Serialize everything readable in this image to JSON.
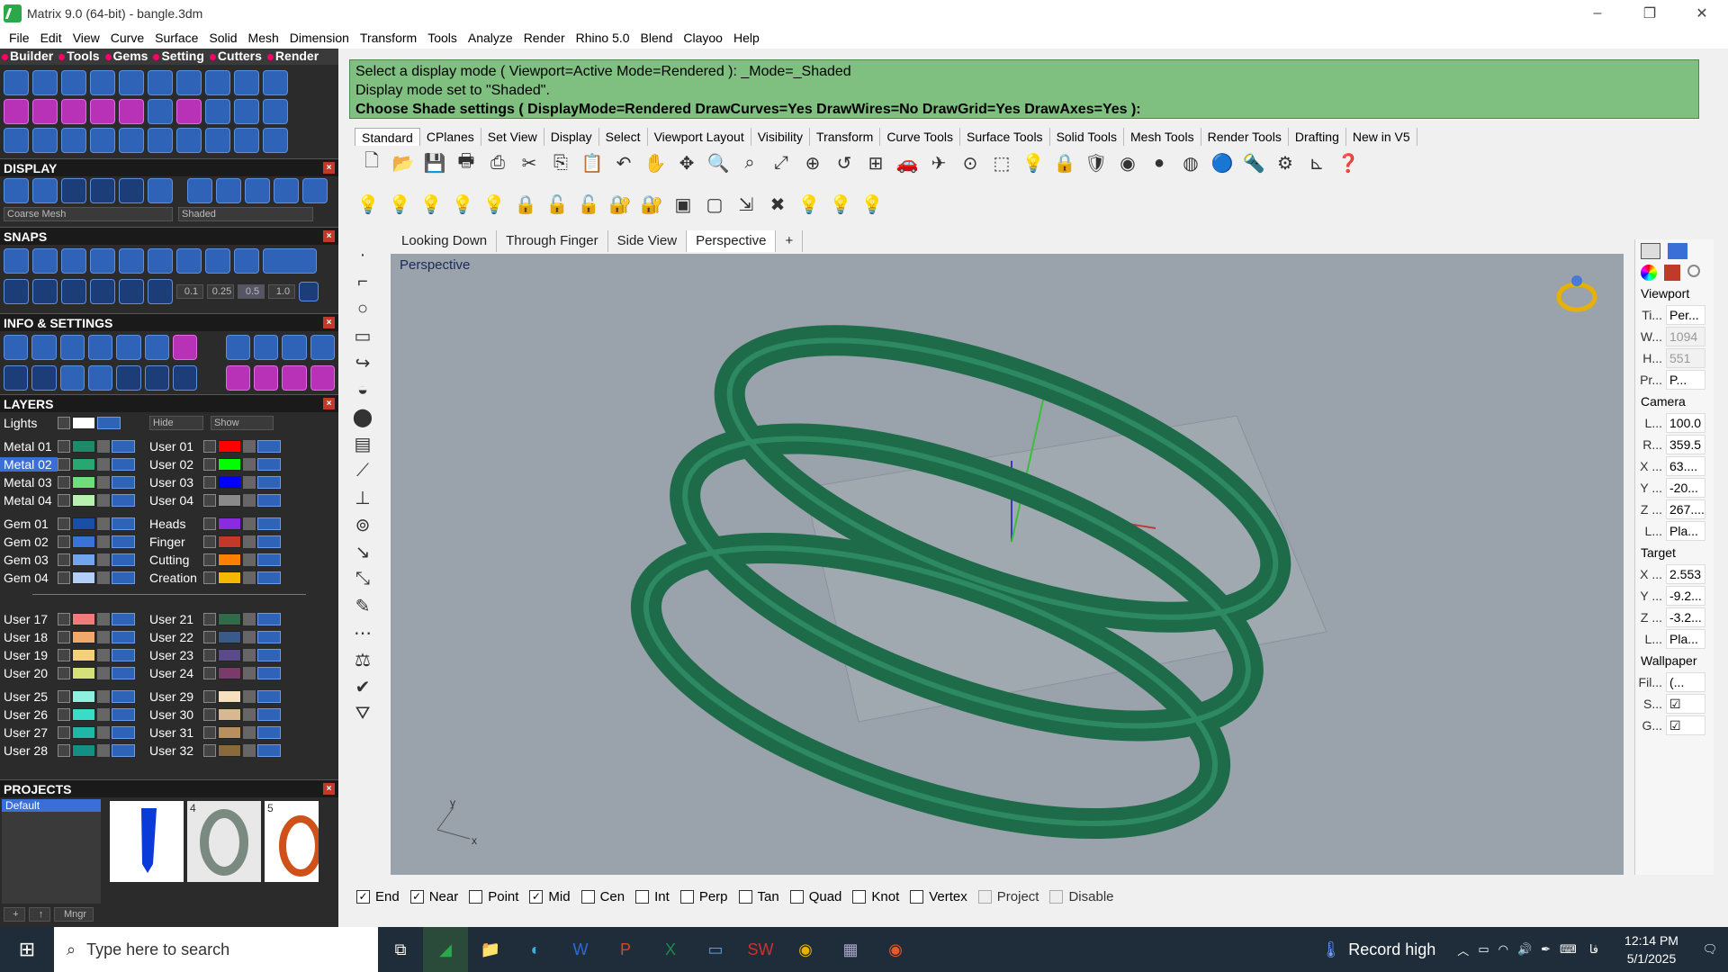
{
  "window": {
    "title": "Matrix 9.0 (64-bit) - bangle.3dm",
    "minimize": "–",
    "restore": "❐",
    "close": "✕"
  },
  "menu": [
    "File",
    "Edit",
    "View",
    "Curve",
    "Surface",
    "Solid",
    "Mesh",
    "Dimension",
    "Transform",
    "Tools",
    "Analyze",
    "Render",
    "Rhino 5.0",
    "Blend",
    "Clayoo",
    "Help"
  ],
  "matrix_tabs": [
    "Builder",
    "Tools",
    "Gems",
    "Setting",
    "Cutters",
    "Render"
  ],
  "display": {
    "header": "DISPLAY",
    "mesh_combo": "Coarse Mesh",
    "mode_combo": "Shaded"
  },
  "snaps": {
    "header": "SNAPS",
    "values": [
      "0.1",
      "0.25",
      "0.5",
      "1.0"
    ]
  },
  "info_settings": {
    "header": "INFO & SETTINGS"
  },
  "layers": {
    "header": "LAYERS",
    "lights": "Lights",
    "hide": "Hide",
    "show": "Show",
    "left_groups": [
      [
        {
          "name": "Metal 01",
          "color": "#1f8a6a"
        },
        {
          "name": "Metal 02",
          "color": "#27a873",
          "selected": true
        },
        {
          "name": "Metal 03",
          "color": "#6fdd7a"
        },
        {
          "name": "Metal 04",
          "color": "#b8f0b0"
        }
      ],
      [
        {
          "name": "Gem 01",
          "color": "#1a4fa8"
        },
        {
          "name": "Gem 02",
          "color": "#3a73d8"
        },
        {
          "name": "Gem 03",
          "color": "#73a4ee"
        },
        {
          "name": "Gem 04",
          "color": "#b2d0f7"
        }
      ],
      [
        {
          "name": "User 17",
          "color": "#f07b7b"
        },
        {
          "name": "User 18",
          "color": "#f0a86b"
        },
        {
          "name": "User 19",
          "color": "#f5d07a"
        },
        {
          "name": "User 20",
          "color": "#d6e07a"
        }
      ],
      [
        {
          "name": "User 25",
          "color": "#8ff0e0"
        },
        {
          "name": "User 26",
          "color": "#3adcc8"
        },
        {
          "name": "User 27",
          "color": "#1fb8a6"
        },
        {
          "name": "User 28",
          "color": "#138f84"
        }
      ]
    ],
    "right_groups": [
      [
        {
          "name": "User 01",
          "color": "#ff0000"
        },
        {
          "name": "User 02",
          "color": "#00ff00"
        },
        {
          "name": "User 03",
          "color": "#0000ff"
        },
        {
          "name": "User 04",
          "color": "#8a8a8a"
        }
      ],
      [
        {
          "name": "Heads",
          "color": "#8a2be2"
        },
        {
          "name": "Finger",
          "color": "#c0392b"
        },
        {
          "name": "Cutting",
          "color": "#ff7f00"
        },
        {
          "name": "Creation",
          "color": "#f5b800"
        }
      ],
      [
        {
          "name": "User 21",
          "color": "#2f6b4a"
        },
        {
          "name": "User 22",
          "color": "#3a5a8a"
        },
        {
          "name": "User 23",
          "color": "#5a4a8a"
        },
        {
          "name": "User 24",
          "color": "#7a3a6a"
        }
      ],
      [
        {
          "name": "User 29",
          "color": "#f5e0c0"
        },
        {
          "name": "User 30",
          "color": "#d8b890"
        },
        {
          "name": "User 31",
          "color": "#b89060"
        },
        {
          "name": "User 32",
          "color": "#8a6a3a"
        }
      ]
    ]
  },
  "projects": {
    "header": "PROJECTS",
    "default": "Default",
    "thumb_numbers": [
      "4",
      "5"
    ],
    "add": "+",
    "up": "↑",
    "manager": "Mngr"
  },
  "command": {
    "line1": "Select a display mode ( Viewport=Active  Mode=Rendered ): _Mode=_Shaded",
    "line2": "Display mode set to \"Shaded\".",
    "line3": "Choose Shade settings ( DisplayMode=Rendered  DrawCurves=Yes  DrawWires=No  DrawGrid=Yes  DrawAxes=Yes ):"
  },
  "toolbar_tabs": [
    "Standard",
    "CPlanes",
    "Set View",
    "Display",
    "Select",
    "Viewport Layout",
    "Visibility",
    "Transform",
    "Curve Tools",
    "Surface Tools",
    "Solid Tools",
    "Mesh Tools",
    "Render Tools",
    "Drafting",
    "New in V5"
  ],
  "viewport_tabs": [
    "Looking Down",
    "Through Finger",
    "Side View",
    "Perspective",
    "+"
  ],
  "viewport_label": "Perspective",
  "axis_labels": {
    "y": "y",
    "x": "x"
  },
  "osnaps": [
    {
      "label": "End",
      "checked": true
    },
    {
      "label": "Near",
      "checked": true
    },
    {
      "label": "Point",
      "checked": false
    },
    {
      "label": "Mid",
      "checked": true
    },
    {
      "label": "Cen",
      "checked": false
    },
    {
      "label": "Int",
      "checked": false
    },
    {
      "label": "Perp",
      "checked": false
    },
    {
      "label": "Tan",
      "checked": false
    },
    {
      "label": "Quad",
      "checked": false
    },
    {
      "label": "Knot",
      "checked": false
    },
    {
      "label": "Vertex",
      "checked": false
    },
    {
      "label": "Project",
      "checked": false,
      "disabled": true
    },
    {
      "label": "Disable",
      "checked": false,
      "disabled": true
    }
  ],
  "properties": {
    "viewport_header": "Viewport",
    "viewport_rows": [
      {
        "k": "Ti...",
        "v": "Per..."
      },
      {
        "k": "W...",
        "v": "1094",
        "gray": true
      },
      {
        "k": "H...",
        "v": "551",
        "gray": true
      },
      {
        "k": "Pr...",
        "v": "P..."
      }
    ],
    "camera_header": "Camera",
    "camera_rows": [
      {
        "k": "L...",
        "v": "100.0"
      },
      {
        "k": "R...",
        "v": "359.5"
      },
      {
        "k": "X ...",
        "v": "63...."
      },
      {
        "k": "Y ...",
        "v": "-20..."
      },
      {
        "k": "Z ...",
        "v": "267...."
      },
      {
        "k": "L...",
        "v": "Pla..."
      }
    ],
    "target_header": "Target",
    "target_rows": [
      {
        "k": "X ...",
        "v": "2.553"
      },
      {
        "k": "Y ...",
        "v": "-9.2..."
      },
      {
        "k": "Z ...",
        "v": "-3.2..."
      },
      {
        "k": "L...",
        "v": "Pla..."
      }
    ],
    "wallpaper_header": "Wallpaper",
    "wallpaper_rows": [
      {
        "k": "Fil...",
        "v": "(..."
      },
      {
        "k": "S...",
        "v": "☑"
      },
      {
        "k": "G...",
        "v": "☑"
      }
    ]
  },
  "taskbar": {
    "search_placeholder": "Type here to search",
    "weather": "Record high",
    "lang": "فا",
    "time": "12:14 PM",
    "date": "5/1/2025"
  },
  "colors": {
    "command_bg": "#7fbf7f",
    "bangle": "#1e6b4a",
    "viewport_bg": "#9aa3ab"
  }
}
